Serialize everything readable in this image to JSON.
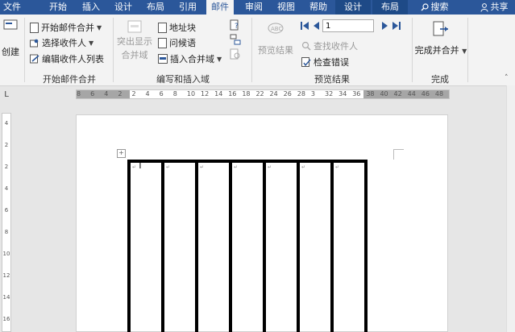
{
  "tabs": [
    "文件",
    "开始",
    "插入",
    "设计",
    "布局",
    "引用",
    "邮件",
    "审阅",
    "视图",
    "帮助",
    "设计",
    "布局"
  ],
  "active_tab": "邮件",
  "search_label": "搜索",
  "share_label": "共享",
  "ribbon": {
    "create_label": "创建",
    "start_merge": {
      "start_label": "开始邮件合并",
      "recipients_label": "选择收件人",
      "edit_list_label": "编辑收件人列表",
      "group_label": "开始邮件合并"
    },
    "write_insert": {
      "highlight_line1": "突出显示",
      "highlight_line2": "合并域",
      "address_label": "地址块",
      "greeting_label": "问候语",
      "insert_field_label": "插入合并域",
      "group_label": "编写和插入域"
    },
    "preview": {
      "preview_label": "预览结果",
      "record_value": "1",
      "find_label": "查找收件人",
      "check_label": "检查错误",
      "group_label": "预览结果"
    },
    "finish": {
      "finish_label": "完成并合并",
      "group_label": "完成"
    }
  },
  "ruler": {
    "h_ticks": [
      "8",
      "6",
      "4",
      "2",
      "2",
      "4",
      "6",
      "8",
      "10",
      "12",
      "14",
      "16",
      "18",
      "22",
      "24",
      "26",
      "28",
      "3",
      "32",
      "34",
      "36",
      "38",
      "40",
      "42",
      "44",
      "46",
      "48"
    ],
    "v_ticks": [
      "4",
      "2",
      "2",
      "4",
      "6",
      "8",
      "10",
      "12",
      "14",
      "16"
    ]
  },
  "table": {
    "columns": 7
  }
}
